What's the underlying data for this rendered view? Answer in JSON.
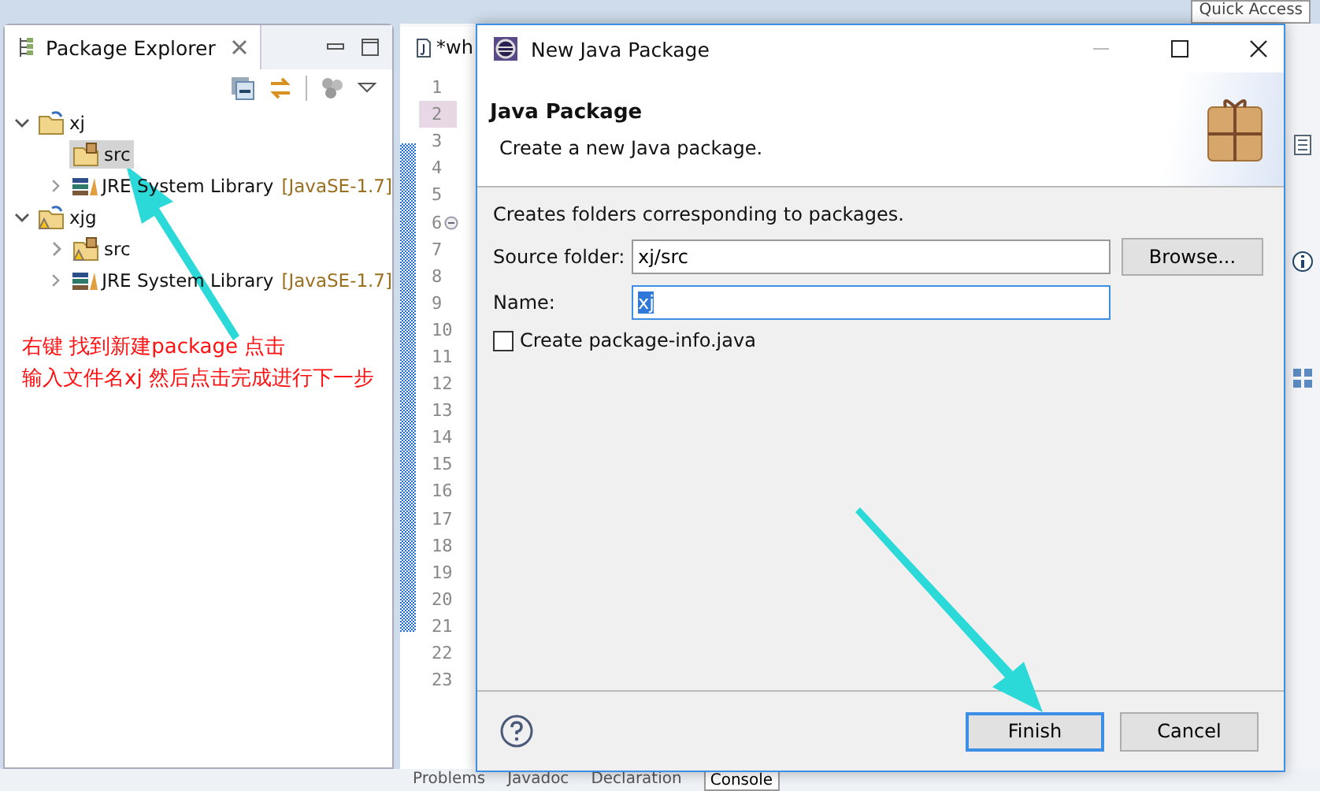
{
  "quick_access": {
    "placeholder": "Quick Access"
  },
  "package_explorer": {
    "title": "Package Explorer",
    "tree": [
      {
        "label": "xj",
        "kind": "project",
        "warning": false,
        "expanded": true,
        "selected": false,
        "children": [
          {
            "label": "src",
            "kind": "source-folder",
            "warning": false,
            "selected": true
          },
          {
            "label": "JRE System Library",
            "decoration": "[JavaSE-1.7]",
            "kind": "library",
            "warning": false,
            "expanded": false,
            "selected": false
          }
        ]
      },
      {
        "label": "xjg",
        "kind": "project",
        "warning": true,
        "expanded": true,
        "selected": false,
        "children": [
          {
            "label": "src",
            "kind": "source-folder",
            "warning": true,
            "expanded": false,
            "selected": false
          },
          {
            "label": "JRE System Library",
            "decoration": "[JavaSE-1.7]",
            "kind": "library",
            "warning": false,
            "expanded": false,
            "selected": false
          }
        ]
      }
    ]
  },
  "editor": {
    "tab": "*wh",
    "lines": [
      {
        "n": "1",
        "highlighted": false,
        "fold": false
      },
      {
        "n": "2",
        "highlighted": true,
        "fold": false
      },
      {
        "n": "3",
        "highlighted": false,
        "fold": false
      },
      {
        "n": "4",
        "highlighted": false,
        "fold": false
      },
      {
        "n": "5",
        "highlighted": false,
        "fold": false
      },
      {
        "n": "6",
        "highlighted": false,
        "fold": true
      },
      {
        "n": "7",
        "highlighted": false,
        "fold": false
      },
      {
        "n": "8",
        "highlighted": false,
        "fold": false
      },
      {
        "n": "9",
        "highlighted": false,
        "fold": false
      },
      {
        "n": "10",
        "highlighted": false,
        "fold": false
      },
      {
        "n": "11",
        "highlighted": false,
        "fold": false
      },
      {
        "n": "12",
        "highlighted": false,
        "fold": false
      },
      {
        "n": "13",
        "highlighted": false,
        "fold": false
      },
      {
        "n": "14",
        "highlighted": false,
        "fold": false
      },
      {
        "n": "15",
        "highlighted": false,
        "fold": false
      },
      {
        "n": "16",
        "highlighted": false,
        "fold": false
      },
      {
        "n": "17",
        "highlighted": false,
        "fold": false
      },
      {
        "n": "18",
        "highlighted": false,
        "fold": false
      },
      {
        "n": "19",
        "highlighted": false,
        "fold": false
      },
      {
        "n": "20",
        "highlighted": false,
        "fold": false
      },
      {
        "n": "21",
        "highlighted": false,
        "fold": false
      },
      {
        "n": "22",
        "highlighted": false,
        "fold": false
      },
      {
        "n": "23",
        "highlighted": false,
        "fold": false
      }
    ]
  },
  "bottom_tabs": [
    {
      "label": "Problems",
      "selected": false
    },
    {
      "label": "Javadoc",
      "selected": false
    },
    {
      "label": "Declaration",
      "selected": false
    },
    {
      "label": "Console",
      "selected": true
    }
  ],
  "dialog": {
    "title": "New Java Package",
    "heading": "Java Package",
    "subtitle": "Create a new Java package.",
    "description": "Creates folders corresponding to packages.",
    "source_folder": {
      "label": "Source folder:",
      "value": "xj/src"
    },
    "browse_button": "Browse...",
    "name": {
      "label": "Name:",
      "value": "xj",
      "text_selected": true
    },
    "package_info": {
      "label": "Create package-info.java",
      "checked": false
    },
    "buttons": [
      {
        "label": "Finish",
        "default": true
      },
      {
        "label": "Cancel",
        "default": false
      }
    ]
  },
  "annotation": {
    "lines": [
      "右键 找到新建package 点击",
      "输入文件名xj 然后点击完成进行下一步"
    ]
  }
}
